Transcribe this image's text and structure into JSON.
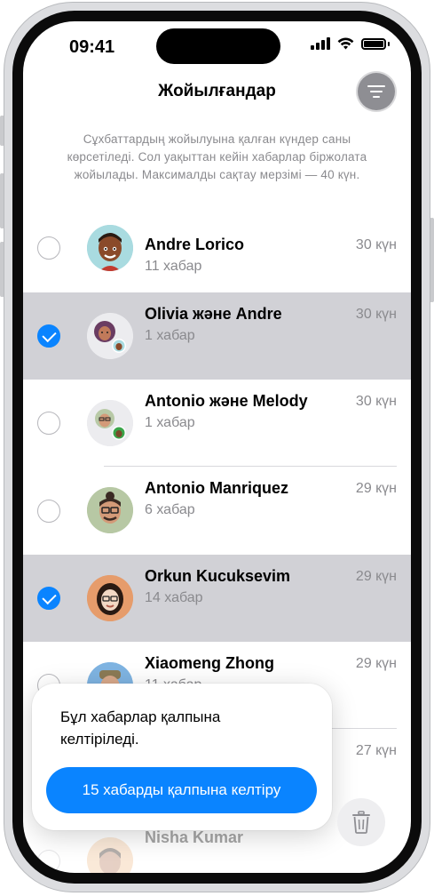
{
  "status_bar": {
    "time": "09:41"
  },
  "header": {
    "title": "Жойылғандар"
  },
  "subtitle": "Сұхбаттардың жойылуына қалған күндер саны көрсетіледі. Сол уақыттан кейін хабарлар біржолата жойылады. Максималды сақтау мерзімі — 40 күн.",
  "conversations": [
    {
      "name": "Andre Lorico",
      "count": "11 хабар",
      "days": "30 күн",
      "selected": false
    },
    {
      "name": "Olivia және Andre",
      "count": "1 хабар",
      "days": "30 күн",
      "selected": true
    },
    {
      "name": "Antonio және Melody",
      "count": "1 хабар",
      "days": "30 күн",
      "selected": false
    },
    {
      "name": "Antonio Manriquez",
      "count": "6 хабар",
      "days": "29 күн",
      "selected": false
    },
    {
      "name": "Orkun Kucuksevim",
      "count": "14 хабар",
      "days": "29 күн",
      "selected": true
    },
    {
      "name": "Xiaomeng Zhong",
      "count": "11 хабар",
      "days": "29 күн",
      "selected": false
    },
    {
      "name": "",
      "count": "",
      "days": "27 күн",
      "selected": false
    },
    {
      "name": "Nisha Kumar",
      "count": "",
      "days": "",
      "selected": false
    }
  ],
  "popup": {
    "message": "Бұл хабарлар қалпына келтіріледі.",
    "button_label": "15 хабарды қалпына келтіру"
  },
  "colors": {
    "accent": "#0a84ff",
    "selected_row": "#d1d1d6",
    "secondary_text": "#8a8a8e"
  },
  "icons": [
    "filter-icon",
    "trash-icon",
    "signal-icon",
    "wifi-icon",
    "battery-icon",
    "checkmark-icon"
  ]
}
